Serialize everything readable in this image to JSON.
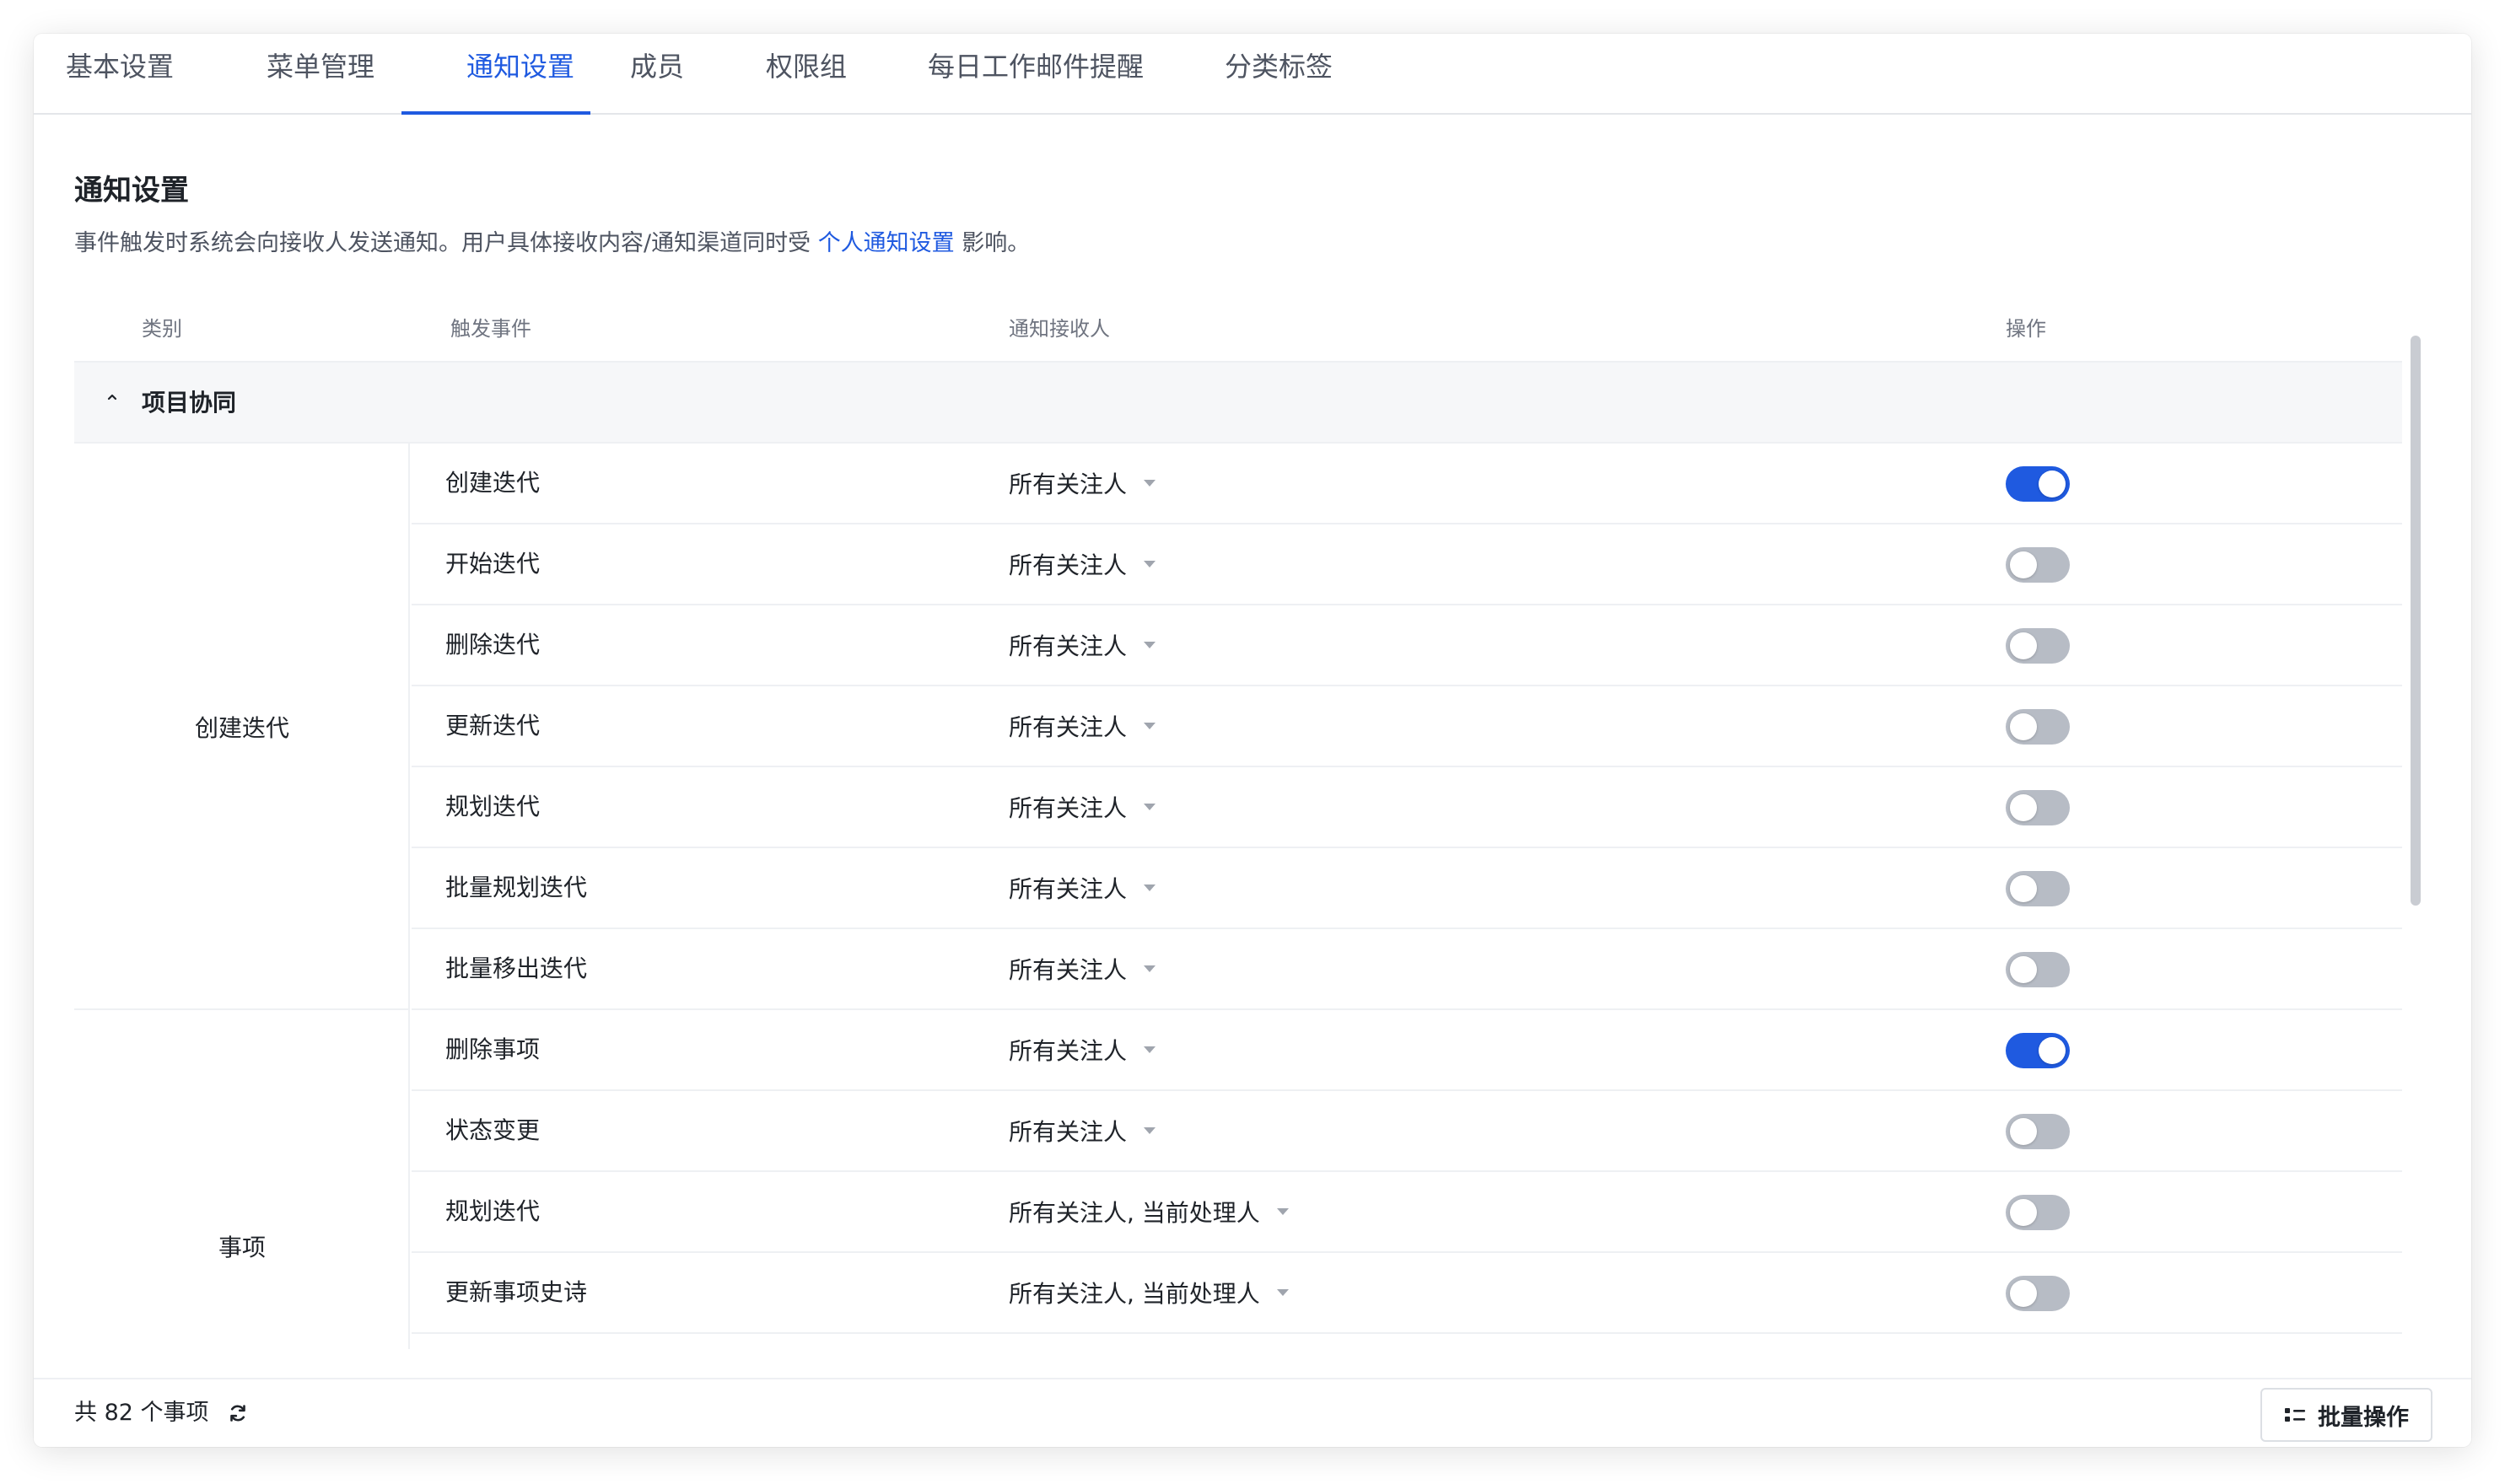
{
  "tabs": [
    {
      "label": "基本设置",
      "active": false
    },
    {
      "label": "菜单管理",
      "active": false
    },
    {
      "label": "通知设置",
      "active": true
    },
    {
      "label": "成员",
      "active": false
    },
    {
      "label": "权限组",
      "active": false
    },
    {
      "label": "每日工作邮件提醒",
      "active": false
    },
    {
      "label": "分类标签",
      "active": false
    }
  ],
  "section": {
    "title": "通知设置",
    "desc_prefix": "事件触发时系统会向接收人发送通知。用户具体接收内容/通知渠道同时受 ",
    "desc_link": "个人通知设置",
    "desc_suffix": " 影响。"
  },
  "table": {
    "headers": {
      "category": "类别",
      "event": "触发事件",
      "recipient": "通知接收人",
      "action": "操作"
    },
    "group": {
      "label": "项目协同",
      "expanded": true
    },
    "categories": [
      {
        "label": "创建迭代",
        "rows": [
          {
            "event": "创建迭代",
            "recipient": "所有关注人",
            "enabled": true
          },
          {
            "event": "开始迭代",
            "recipient": "所有关注人",
            "enabled": false
          },
          {
            "event": "删除迭代",
            "recipient": "所有关注人",
            "enabled": false
          },
          {
            "event": "更新迭代",
            "recipient": "所有关注人",
            "enabled": false
          },
          {
            "event": "规划迭代",
            "recipient": "所有关注人",
            "enabled": false
          },
          {
            "event": "批量规划迭代",
            "recipient": "所有关注人",
            "enabled": false
          },
          {
            "event": "批量移出迭代",
            "recipient": "所有关注人",
            "enabled": false
          }
        ]
      },
      {
        "label": "事项",
        "rows": [
          {
            "event": "删除事项",
            "recipient": "所有关注人",
            "enabled": true
          },
          {
            "event": "状态变更",
            "recipient": "所有关注人",
            "enabled": false
          },
          {
            "event": "规划迭代",
            "recipient": "所有关注人, 当前处理人",
            "enabled": false
          },
          {
            "event": "更新事项史诗",
            "recipient": "所有关注人, 当前处理人",
            "enabled": false
          }
        ]
      }
    ]
  },
  "footer": {
    "count_text": "共 82 个事项",
    "batch_label": "批量操作"
  },
  "colors": {
    "accent": "#1f5ae0",
    "toggle_off": "#b7bcc5"
  }
}
